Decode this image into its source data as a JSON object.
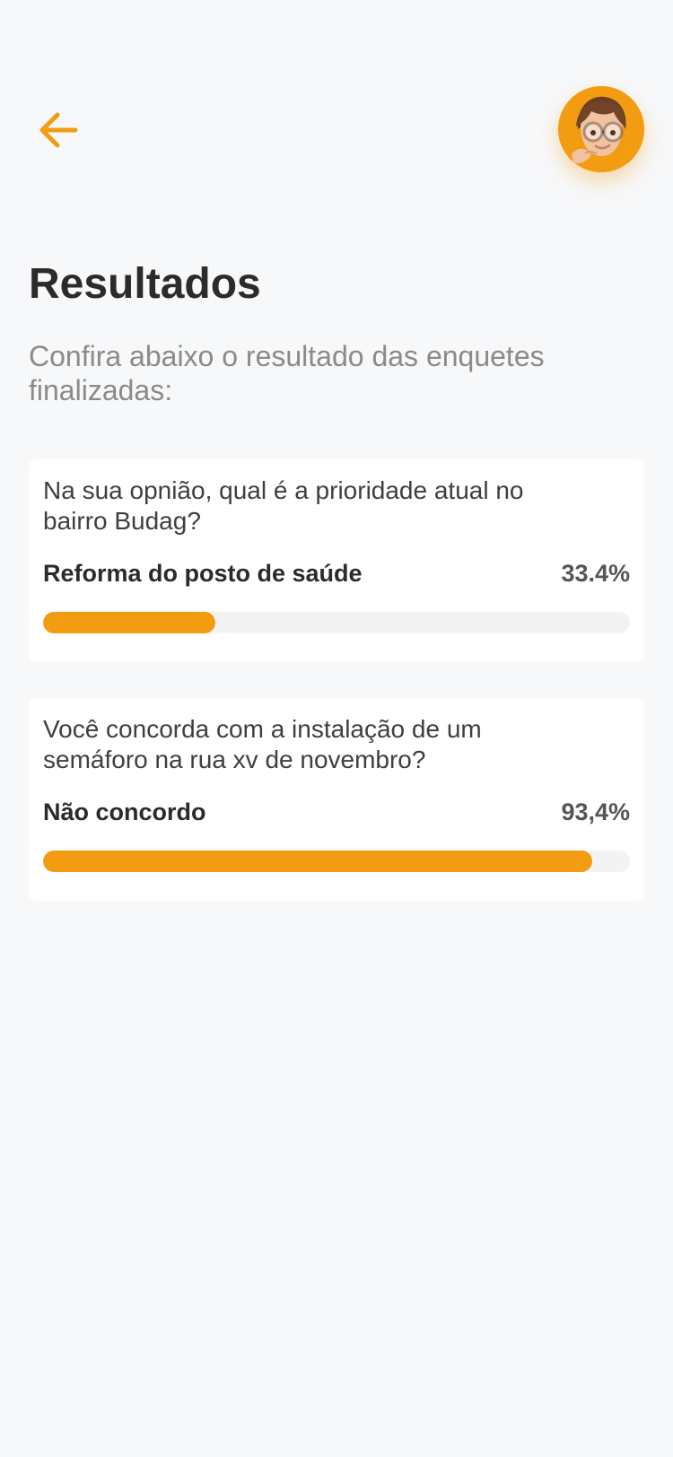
{
  "colors": {
    "accent": "#f39c12",
    "background": "#f7f8fa",
    "card": "#ffffff",
    "track": "#f3f3f3"
  },
  "header": {
    "back_icon": "arrow-left-icon",
    "avatar_icon": "user-avatar-memoji"
  },
  "page": {
    "title": "Resultados",
    "subtitle": "Confira abaixo o resultado das enquetes finalizadas:"
  },
  "polls": [
    {
      "question": "Na sua opnião, qual é a prioridade atual no bairro Budag?",
      "option": "Reforma do posto de saúde",
      "percent_label": "33.4%",
      "percent": 29.4
    },
    {
      "question": "Você concorda com a instalação de um semáforo na rua xv de novembro?",
      "option": "Não concordo",
      "percent_label": "93,4%",
      "percent": 93.6
    }
  ]
}
